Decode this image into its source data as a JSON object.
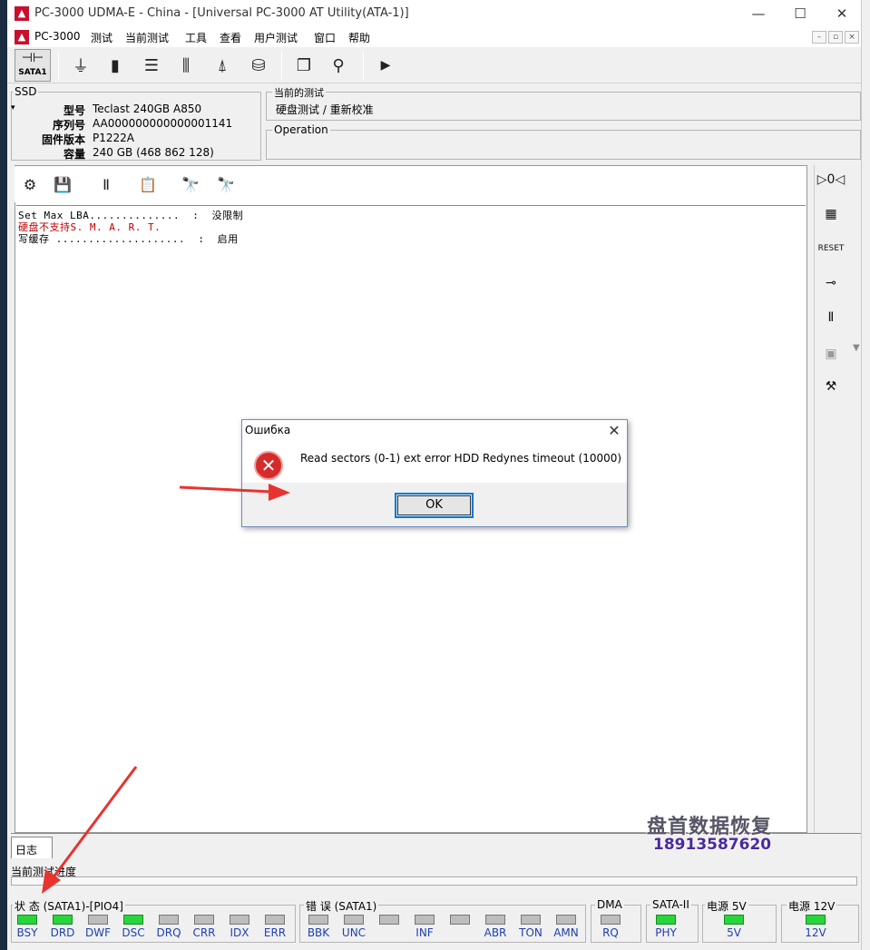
{
  "window": {
    "title": "PC-3000 UDMA-E - China - [Universal PC-3000 AT Utility(ATA-1)]"
  },
  "menu": [
    "PC-3000",
    "测试",
    "当前测试",
    "工具",
    "查看",
    "用户测试",
    "窗口",
    "帮助"
  ],
  "toolbar": {
    "sata_label": "SATA1"
  },
  "ssd": {
    "group_label": "SSD",
    "rows": [
      {
        "label": "型号",
        "value": "Teclast 240GB A850"
      },
      {
        "label": "序列号",
        "value": "AA000000000000001141"
      },
      {
        "label": "固件版本",
        "value": "P1222A"
      },
      {
        "label": "容量",
        "value": "240 GB (468 862 128)"
      }
    ]
  },
  "current_test": {
    "label": "当前的测试",
    "value": "硬盘测试 / 重新校准"
  },
  "operation": {
    "label": "Operation"
  },
  "log": {
    "lines": [
      {
        "text": "Set Max LBA..............  :  没限制",
        "color": "#000"
      },
      {
        "text": "硬盘不支持S. M. A. R. T.",
        "color": "#c00000"
      },
      {
        "text": "写缓存 ....................  :  启用",
        "color": "#000"
      }
    ]
  },
  "tabs": {
    "log": "日志"
  },
  "progress": {
    "label": "当前测试进度"
  },
  "dialog": {
    "title": "Ошибка",
    "message": "Read sectors (0-1) ext error HDD Redynes timeout (10000)",
    "ok": "OK"
  },
  "watermark": {
    "line1": "盘首数据恢复",
    "line2": "18913587620"
  },
  "status": {
    "groups": [
      {
        "label": "状 态 (SATA1)-[PIO4]",
        "items": [
          {
            "name": "BSY",
            "on": true
          },
          {
            "name": "DRD",
            "on": true
          },
          {
            "name": "DWF",
            "on": false
          },
          {
            "name": "DSC",
            "on": true
          },
          {
            "name": "DRQ",
            "on": false
          },
          {
            "name": "CRR",
            "on": false
          },
          {
            "name": "IDX",
            "on": false
          },
          {
            "name": "ERR",
            "on": false
          }
        ]
      },
      {
        "label": "错 误 (SATA1)",
        "items": [
          {
            "name": "BBK",
            "on": false
          },
          {
            "name": "UNC",
            "on": false
          },
          {
            "name": "",
            "on": false
          },
          {
            "name": "INF",
            "on": false
          },
          {
            "name": "",
            "on": false
          },
          {
            "name": "ABR",
            "on": false
          },
          {
            "name": "TON",
            "on": false
          },
          {
            "name": "AMN",
            "on": false
          }
        ]
      },
      {
        "label": "DMA",
        "items": [
          {
            "name": "RQ",
            "on": false
          }
        ]
      },
      {
        "label": "SATA-II",
        "items": [
          {
            "name": "PHY",
            "on": true
          }
        ]
      },
      {
        "label": "电源 5V",
        "items": [
          {
            "name": "5V",
            "on": true
          }
        ]
      },
      {
        "label": "电源 12V",
        "items": [
          {
            "name": "12V",
            "on": true
          }
        ]
      }
    ]
  },
  "colors": {
    "accent": "#0078d7",
    "led_on": "#27d63a",
    "led_off": "#bdbdbd",
    "status_text": "#1f3fb0",
    "arrow": "#e8332f"
  }
}
